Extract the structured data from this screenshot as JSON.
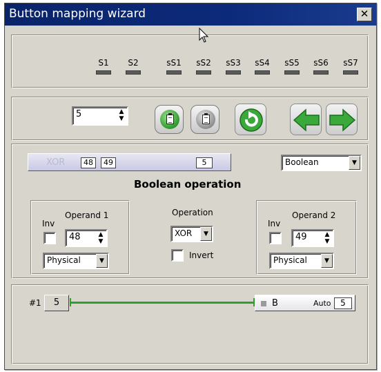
{
  "window": {
    "title": "Button mapping wizard",
    "close_label": "✕"
  },
  "signals": [
    "S1",
    "S2",
    "sS1",
    "sS2",
    "sS3",
    "sS4",
    "sS5",
    "sS6",
    "sS7"
  ],
  "toolbar": {
    "number_value": "5",
    "up_arrow": "▲",
    "down_arrow": "▼",
    "icons": [
      "clipboard-paste-icon",
      "clipboard-disabled-icon",
      "refresh-icon",
      "arrow-left-icon",
      "arrow-right-icon"
    ],
    "accent_green": "#3aa83a"
  },
  "expression": {
    "ghost_text": "XOR",
    "operand1_chip": "48",
    "operand2_chip": "49",
    "result_chip": "5",
    "type_value": "Boolean",
    "heading": "Boolean operation"
  },
  "operand1": {
    "group_title": "Operand 1",
    "inv_label": "Inv",
    "value": "48",
    "source": "Physical"
  },
  "operation": {
    "title": "Operation",
    "value": "XOR",
    "invert_label": "Invert"
  },
  "operand2": {
    "group_title": "Operand 2",
    "inv_label": "Inv",
    "value": "49",
    "source": "Physical"
  },
  "mapping": {
    "index_label": "#1",
    "source_button": "5",
    "target_label": "B",
    "auto_label": "Auto",
    "target_value": "5",
    "line_color": "#2fa02f"
  }
}
